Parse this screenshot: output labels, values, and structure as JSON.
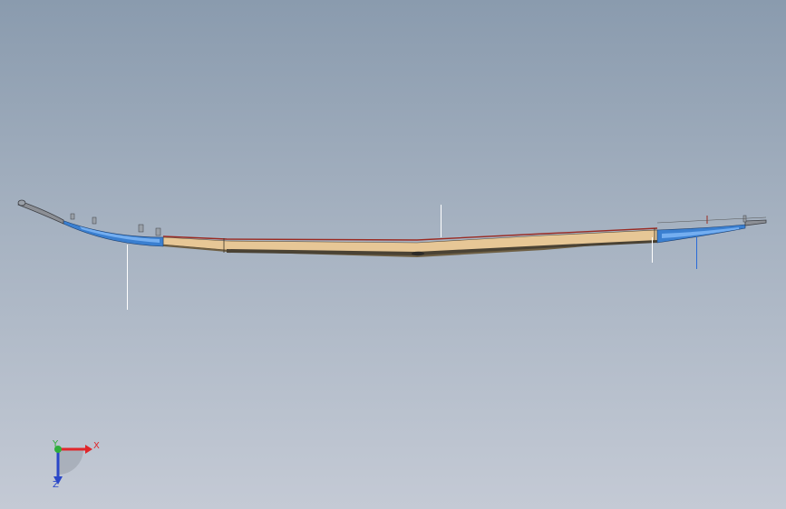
{
  "viewport": {
    "background_top": "#8a9bae",
    "background_bottom": "#c4cad5",
    "name": "graphics-area"
  },
  "model": {
    "name": "leaf-spring-assembly",
    "colors": {
      "leaf_main": "#e7c796",
      "leaf_shadow": "#7a6a4c",
      "leaf_dark": "#3e3a33",
      "end_blue": "#3a7fd0",
      "end_blue_light": "#74aef0",
      "red_edge": "#9a2a22",
      "eye": "#8c8f95"
    }
  },
  "triad": {
    "x_label": "X",
    "y_label": "Y",
    "z_label": "Z",
    "x_color": "#e0262a",
    "y_color": "#2fae3a",
    "z_color": "#2a47c8",
    "icon": "coordinate-triad-icon"
  }
}
